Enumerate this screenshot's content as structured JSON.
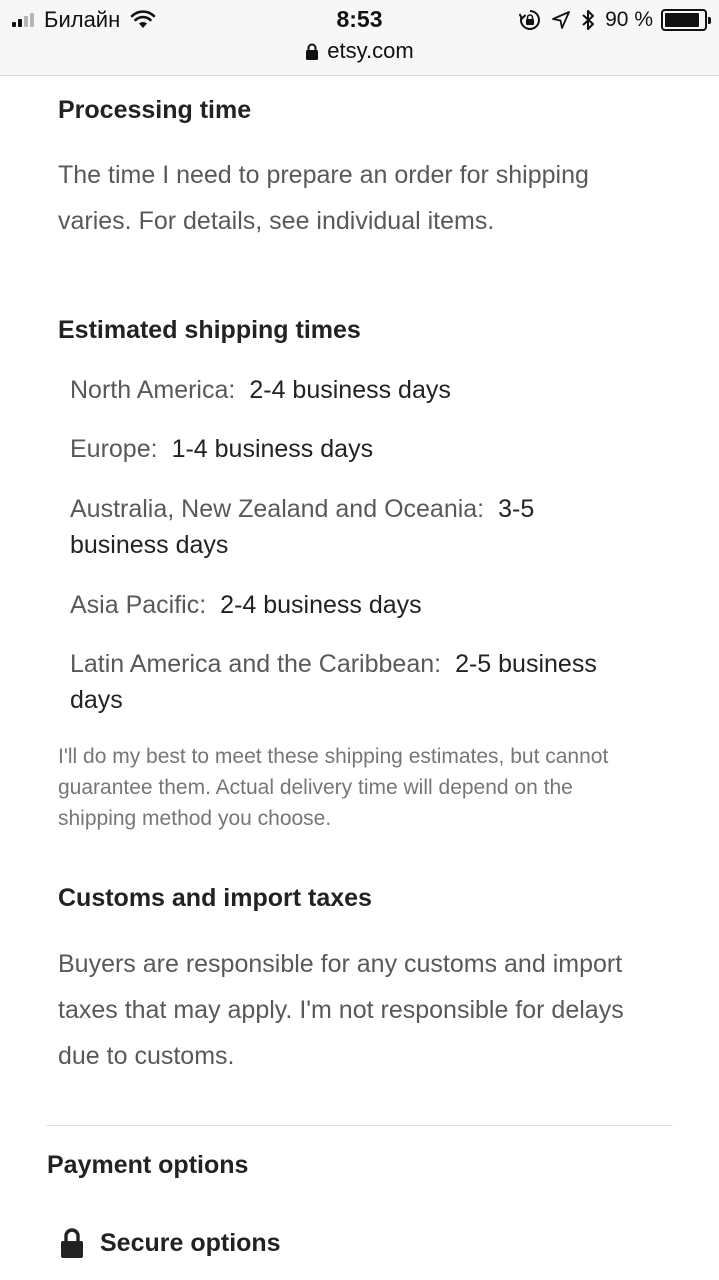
{
  "status_bar": {
    "carrier": "Билайн",
    "time": "8:53",
    "url": "etsy.com",
    "battery_text": "90 %",
    "battery_level": 0.9,
    "icons": [
      "signal-icon",
      "wifi-icon",
      "lock-icon",
      "rotation-lock-icon",
      "location-arrow-icon",
      "bluetooth-icon",
      "battery-icon"
    ]
  },
  "processing": {
    "title": "Processing time",
    "text": "The time I need to prepare an order for shipping varies. For details, see individual items."
  },
  "shipping": {
    "title": "Estimated shipping times",
    "items": [
      {
        "region": "North America:",
        "time": "2-4 business days"
      },
      {
        "region": "Europe:",
        "time": "1-4 business days"
      },
      {
        "region": "Australia, New Zealand and Oceania:",
        "time": "3-5 business days"
      },
      {
        "region": "Asia Pacific:",
        "time": "2-4 business days"
      },
      {
        "region": "Latin America and the Caribbean:",
        "time": "2-5 business days"
      }
    ],
    "note": "I'll do my best to meet these shipping estimates, but cannot guarantee them. Actual delivery time will depend on the shipping method you choose."
  },
  "customs": {
    "title": "Customs and import taxes",
    "text": "Buyers are responsible for any customs and import taxes that may apply. I'm not responsible for delays due to customs."
  },
  "payment": {
    "title": "Payment options",
    "secure_label": "Secure options"
  }
}
